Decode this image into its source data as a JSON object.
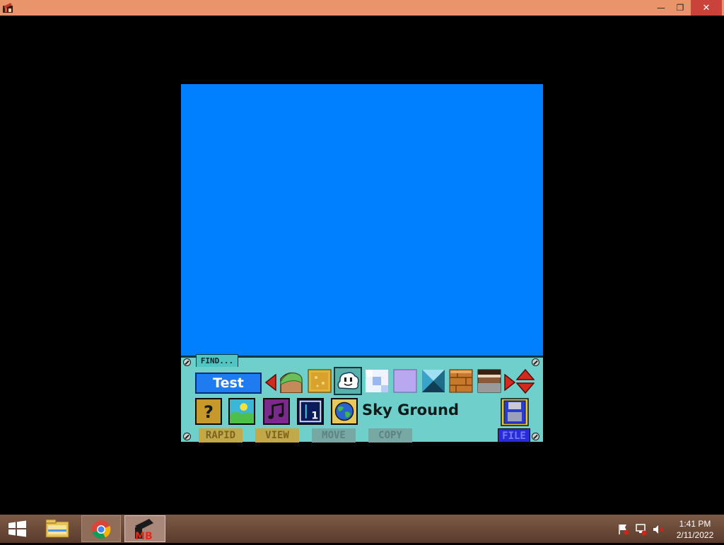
{
  "window": {
    "title": "",
    "minimize_glyph": "—",
    "restore_glyph": "❐",
    "close_glyph": "✕",
    "title_bar_color": "#e9946b"
  },
  "game": {
    "background_color": "#0080ff"
  },
  "editor": {
    "find_label": "FIND...",
    "test_label": "Test",
    "stage_name": "Sky Ground",
    "part_tiles": [
      {
        "icon": "grass-ground-tile-icon"
      },
      {
        "icon": "yellow-block-tile-icon"
      },
      {
        "icon": "cloud-tile-icon",
        "selected": true
      },
      {
        "icon": "white-blue-checker-tile-icon"
      },
      {
        "icon": "lavender-block-tile-icon"
      },
      {
        "icon": "hard-block-tile-icon"
      },
      {
        "icon": "brown-brick-tile-icon"
      },
      {
        "icon": "dirt-ground-tile-icon"
      }
    ],
    "tools": [
      {
        "icon": "question-block-icon"
      },
      {
        "icon": "scenery-sun-icon"
      },
      {
        "icon": "music-note-icon"
      },
      {
        "icon": "subarea-1-icon",
        "label": "1"
      },
      {
        "icon": "globe-icon"
      }
    ],
    "modes": {
      "rapid": "RAPID",
      "view": "VIEW",
      "move": "MOVE",
      "copy": "COPY",
      "file": "FILE"
    }
  },
  "taskbar": {
    "items": [
      {
        "name": "start",
        "icon": "windows-start-icon"
      },
      {
        "name": "file-explorer",
        "icon": "folder-icon"
      },
      {
        "name": "chrome",
        "icon": "chrome-icon"
      },
      {
        "name": "mario-builder",
        "icon": "mario-builder-icon",
        "active": true
      }
    ],
    "tray_icons": [
      "action-center-flag-icon",
      "network-icon",
      "volume-muted-icon"
    ],
    "time": "1:41 PM",
    "date": "2/11/2022"
  }
}
